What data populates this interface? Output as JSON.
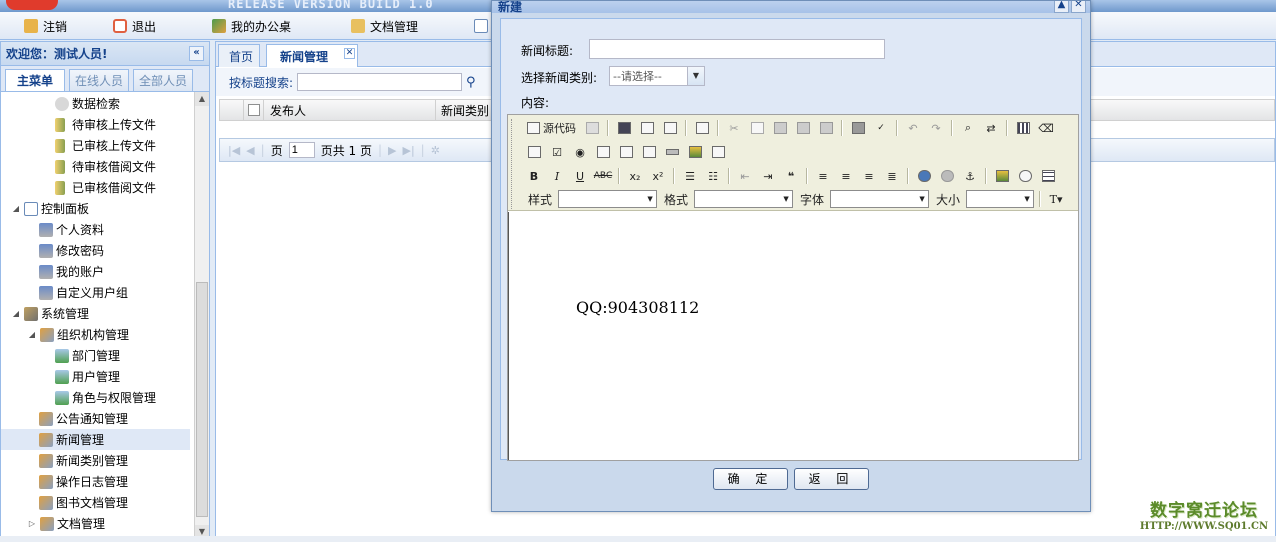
{
  "banner": {
    "build_text": "RELEASE VERSION BUILD 1.0"
  },
  "toolbar": {
    "logout": "注销",
    "exit": "退出",
    "my_desk": "我的办公桌",
    "doc_manage": "文档管理"
  },
  "left": {
    "welcome": "欢迎您：测试人员!",
    "tabs": [
      "主菜单",
      "在线人员",
      "全部人员"
    ],
    "tree": [
      {
        "label": "数据检索",
        "icon": "search-icon"
      },
      {
        "label": "待审核上传文件",
        "icon": "file-icon"
      },
      {
        "label": "已审核上传文件",
        "icon": "file-icon"
      },
      {
        "label": "待审核借阅文件",
        "icon": "file-icon"
      },
      {
        "label": "已审核借阅文件",
        "icon": "file-icon"
      },
      {
        "label": "控制面板",
        "icon": "control-panel-icon"
      },
      {
        "label": "个人资料",
        "icon": "user-icon"
      },
      {
        "label": "修改密码",
        "icon": "user-icon"
      },
      {
        "label": "我的账户",
        "icon": "user-icon"
      },
      {
        "label": "自定义用户组",
        "icon": "user-icon"
      },
      {
        "label": "系统管理",
        "icon": "tools-icon"
      },
      {
        "label": "组织机构管理",
        "icon": "module-icon"
      },
      {
        "label": "部门管理",
        "icon": "monitor-icon"
      },
      {
        "label": "用户管理",
        "icon": "monitor-icon"
      },
      {
        "label": "角色与权限管理",
        "icon": "monitor-icon"
      },
      {
        "label": "公告通知管理",
        "icon": "module-icon"
      },
      {
        "label": "新闻管理",
        "icon": "module-icon"
      },
      {
        "label": "新闻类别管理",
        "icon": "module-icon"
      },
      {
        "label": "操作日志管理",
        "icon": "module-icon"
      },
      {
        "label": "图书文档管理",
        "icon": "module-icon"
      },
      {
        "label": "文档管理",
        "icon": "module-icon"
      }
    ]
  },
  "main": {
    "tabs": [
      "首页",
      "新闻管理"
    ],
    "search_label": "按标题搜索:",
    "columns": [
      "发布人",
      "新闻类别"
    ],
    "pager": {
      "page_prefix": "页",
      "page_value": "1",
      "page_total": "页共 1 页"
    }
  },
  "modal": {
    "title": "新建",
    "news_title_label": "新闻标题:",
    "category_label": "选择新闻类别:",
    "category_placeholder": "--请选择--",
    "content_label": "内容:",
    "editor": {
      "source_label": "源代码",
      "style_label": "样式",
      "format_label": "格式",
      "font_label": "字体",
      "size_label": "大小",
      "content_text": "QQ:904308112"
    },
    "ok_button": "确 定",
    "back_button": "返 回"
  },
  "watermark": {
    "line1": "数字窝迁论坛",
    "line2": "HTTP://WWW.SQ01.CN"
  }
}
